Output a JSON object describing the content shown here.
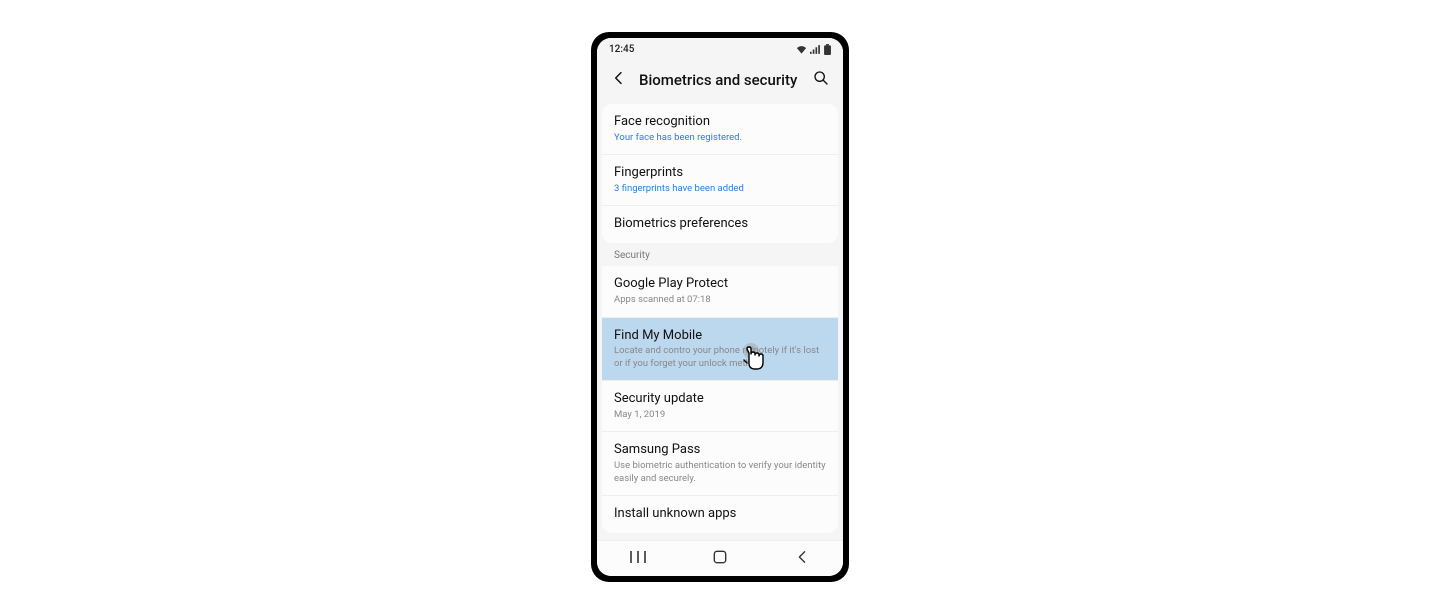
{
  "statusbar": {
    "time": "12:45"
  },
  "header": {
    "title": "Biometrics and security"
  },
  "biometrics": {
    "face": {
      "title": "Face recognition",
      "sub": "Your face has been registered."
    },
    "fingerprints": {
      "title": "Fingerprints",
      "sub": "3 fingerprints have been added"
    },
    "preferences": {
      "title": "Biometrics preferences"
    }
  },
  "security": {
    "header": "Security",
    "play_protect": {
      "title": "Google Play Protect",
      "sub": "Apps scanned at 07:18"
    },
    "find_my_mobile": {
      "title": "Find My Mobile",
      "sub": "Locate and contro your phone remotely if it's lost or if you forget your unlock method."
    },
    "security_update": {
      "title": "Security update",
      "sub": "May 1, 2019"
    },
    "samsung_pass": {
      "title": "Samsung Pass",
      "sub": "Use biometric authentication to verify your identity easily and securely."
    },
    "install_unknown": {
      "title": "Install unknown apps"
    }
  }
}
